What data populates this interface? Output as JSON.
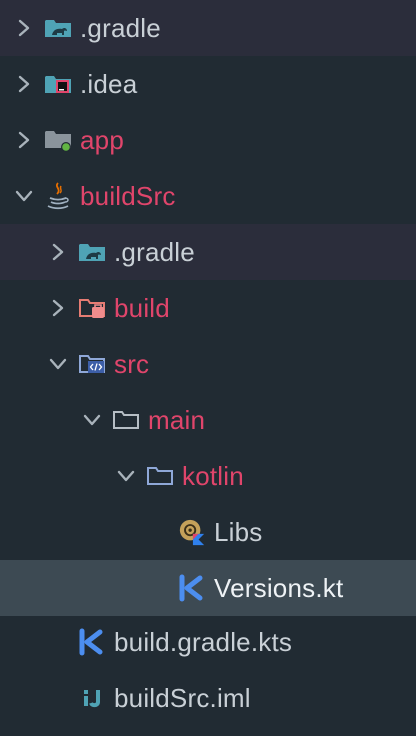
{
  "tree": {
    "items": [
      {
        "label": ".gradle",
        "icon": "gradle-folder-icon",
        "expanded": false
      },
      {
        "label": ".idea",
        "icon": "idea-folder-icon",
        "expanded": false
      },
      {
        "label": "app",
        "icon": "module-folder-icon",
        "expanded": false
      },
      {
        "label": "buildSrc",
        "icon": "java-module-icon",
        "expanded": true
      },
      {
        "label": ".gradle",
        "icon": "gradle-folder-icon",
        "expanded": false
      },
      {
        "label": "build",
        "icon": "build-folder-icon",
        "expanded": false
      },
      {
        "label": "src",
        "icon": "source-folder-icon",
        "expanded": true
      },
      {
        "label": "main",
        "icon": "folder-icon",
        "expanded": true
      },
      {
        "label": "kotlin",
        "icon": "source-root-folder-icon",
        "expanded": true
      },
      {
        "label": "Libs",
        "icon": "kotlin-object-icon"
      },
      {
        "label": "Versions.kt",
        "icon": "kotlin-file-icon",
        "selected": true
      },
      {
        "label": "build.gradle.kts",
        "icon": "kotlin-script-icon"
      },
      {
        "label": "buildSrc.iml",
        "icon": "iml-file-icon"
      }
    ]
  },
  "colors": {
    "background": "#212b33",
    "row_highlight": "#2b2d3b",
    "selection": "#3d4a53",
    "text": "#c9d0d6",
    "excluded_red": "#e0456b"
  }
}
